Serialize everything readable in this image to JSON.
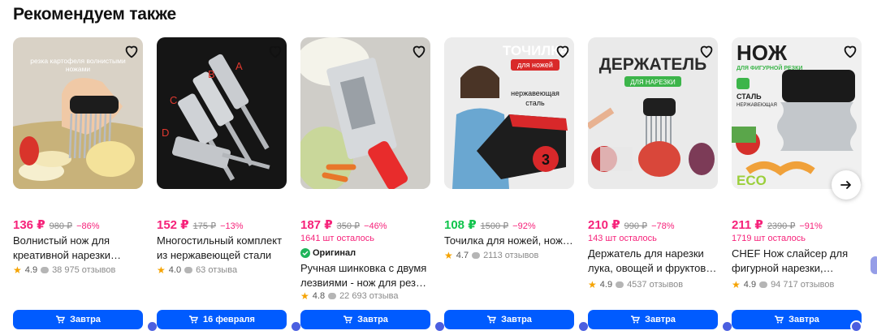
{
  "section": {
    "title": "Рекомендуем также"
  },
  "cards": [
    {
      "price": "136 ₽",
      "old_price": "980 ₽",
      "discount": "−86%",
      "name_line1": "Волнистый нож для",
      "name_line2": "креативной нарезки…",
      "rating": "4.9",
      "reviews": "38 975 отзывов",
      "delivery": "Завтра",
      "image_caption1": "резка картофеля волнистыми",
      "image_caption2": "ножами"
    },
    {
      "price": "152 ₽",
      "old_price": "175 ₽",
      "discount": "−13%",
      "name_line1": "Многостильный комплект",
      "name_line2": "из нержавеющей стали",
      "rating": "4.0",
      "reviews": "63 отзыва",
      "delivery": "16 февраля",
      "img_letters": [
        "A",
        "B",
        "C",
        "D"
      ]
    },
    {
      "price": "187 ₽",
      "old_price": "350 ₽",
      "discount": "−46%",
      "stock": "1641 шт осталось",
      "original": "Оригинал",
      "name_line1": "Ручная шинковка с двумя",
      "name_line2": "лезвиями - нож для резки…",
      "rating": "4.8",
      "reviews": "22 693 отзыва",
      "delivery": "Завтра"
    },
    {
      "price": "108 ₽",
      "old_price": "1500 ₽",
      "discount": "−92%",
      "name_line1": "Точилка для ножей, ножниц",
      "rating": "4.7",
      "reviews": "2113 отзывов",
      "delivery": "Завтра",
      "img_title": "ТОЧИЛКА",
      "img_sub": "для ножей",
      "img_text1": "нержавеющая",
      "img_text2": "сталь",
      "img_num": "3"
    },
    {
      "price": "210 ₽",
      "old_price": "990 ₽",
      "discount": "−78%",
      "stock": "143 шт осталось",
      "name_line1": "Держатель для нарезки",
      "name_line2": "лука, овощей и фруктов,…",
      "rating": "4.9",
      "reviews": "4537 отзывов",
      "delivery": "Завтра",
      "img_title": "ДЕРЖАТЕЛЬ",
      "img_sub": "ДЛЯ НАРЕЗКИ"
    },
    {
      "price": "211 ₽",
      "old_price": "2390 ₽",
      "discount": "−91%",
      "stock": "1719 шт осталось",
      "name_line1": "CHEF Нож слайсер для",
      "name_line2": "фигурной нарезки,…",
      "rating": "4.9",
      "reviews": "94 717 отзывов",
      "delivery": "Завтра",
      "img_title": "НОЖ",
      "img_sub": "ДЛЯ ФИГУРНОЙ РЕЗКИ",
      "img_steel": "СТАЛЬ",
      "img_steel2": "НЕРЖАВЕЮЩАЯ",
      "img_eco": "ECO"
    }
  ],
  "colors": {
    "price": "#f6227a",
    "price_green": "#10c44c",
    "button": "#005bff",
    "star": "#f5a300"
  },
  "icons": {
    "favorite": "heart-outline-icon",
    "next": "arrow-right-icon",
    "cart": "cart-icon",
    "star": "star-icon"
  }
}
